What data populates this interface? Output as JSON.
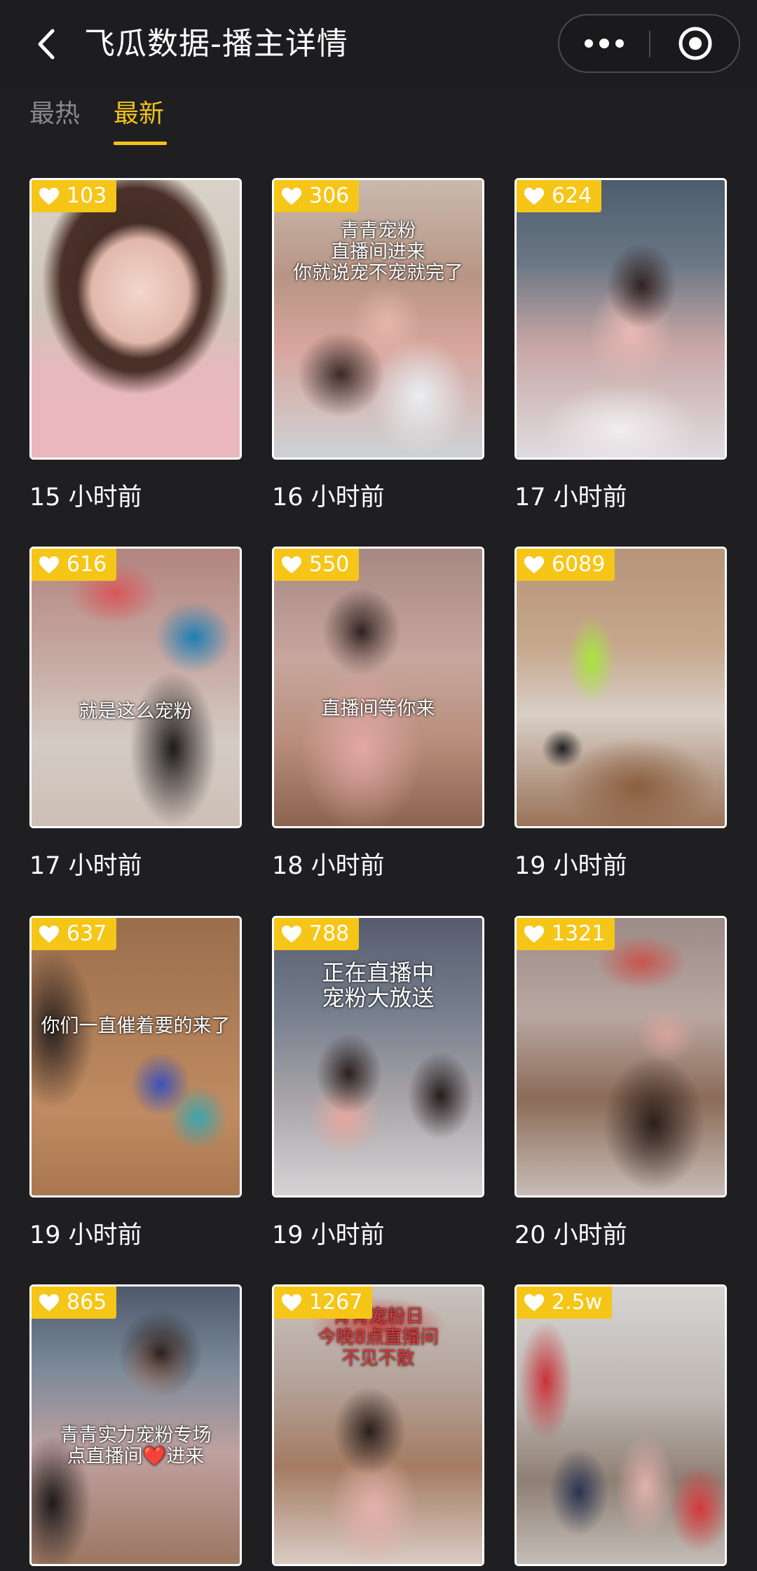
{
  "header": {
    "title": "飞瓜数据-播主详情"
  },
  "tabs": [
    {
      "label": "最热",
      "active": false
    },
    {
      "label": "最新",
      "active": true
    }
  ],
  "accent_color": "#f2c21b",
  "videos": [
    {
      "likes": "103",
      "time": "15 小时前",
      "overlay": ""
    },
    {
      "likes": "306",
      "time": "16 小时前",
      "overlay": "青青宠粉\n直播间进来\n你就说宠不宠就完了"
    },
    {
      "likes": "624",
      "time": "17 小时前",
      "overlay": ""
    },
    {
      "likes": "616",
      "time": "17 小时前",
      "overlay": "就是这么宠粉"
    },
    {
      "likes": "550",
      "time": "18 小时前",
      "overlay": "直播间等你来"
    },
    {
      "likes": "6089",
      "time": "19 小时前",
      "overlay": ""
    },
    {
      "likes": "637",
      "time": "19 小时前",
      "overlay": "你们一直催着要的来了"
    },
    {
      "likes": "788",
      "time": "19 小时前",
      "overlay": "正在直播中\n宠粉大放送"
    },
    {
      "likes": "1321",
      "time": "20 小时前",
      "overlay": ""
    },
    {
      "likes": "865",
      "time": "",
      "overlay": "青青实力宠粉专场\n点直播间❤️进来"
    },
    {
      "likes": "1267",
      "time": "",
      "overlay": "青青宠粉日\n今晚8点直播间\n不见不散"
    },
    {
      "likes": "2.5w",
      "time": "",
      "overlay": ""
    }
  ]
}
